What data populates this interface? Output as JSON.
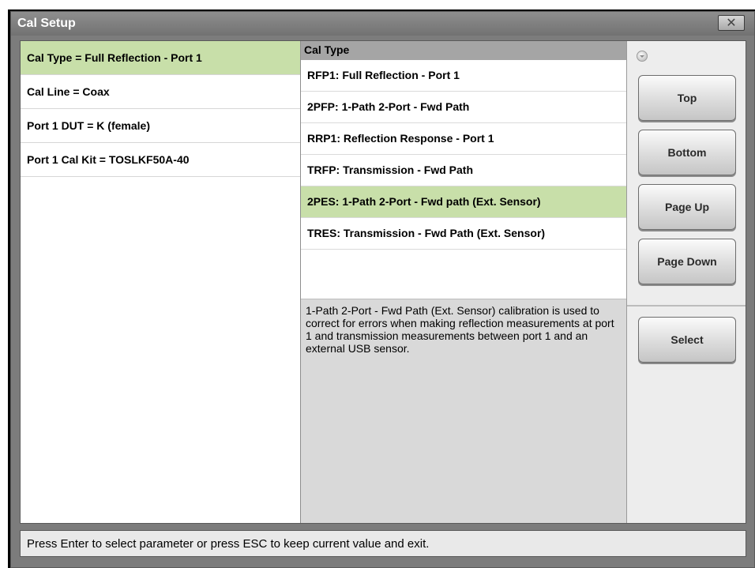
{
  "window": {
    "title": "Cal Setup",
    "close_symbol": "✕"
  },
  "left_panel": {
    "items": [
      {
        "label": "Cal Type = Full Reflection - Port 1",
        "selected": true
      },
      {
        "label": "Cal Line = Coax",
        "selected": false
      },
      {
        "label": "Port 1 DUT = K (female)",
        "selected": false
      },
      {
        "label": "Port 1 Cal Kit = TOSLKF50A-40",
        "selected": false
      }
    ]
  },
  "middle_panel": {
    "header": "Cal Type",
    "options": [
      {
        "label": "RFP1: Full Reflection - Port 1",
        "selected": false
      },
      {
        "label": "2PFP: 1-Path 2-Port - Fwd Path",
        "selected": false
      },
      {
        "label": "RRP1: Reflection Response - Port 1",
        "selected": false
      },
      {
        "label": "TRFP: Transmission - Fwd Path",
        "selected": false
      },
      {
        "label": "2PES: 1-Path 2-Port - Fwd path (Ext. Sensor)",
        "selected": true
      },
      {
        "label": "TRES: Transmission - Fwd Path (Ext. Sensor)",
        "selected": false
      }
    ],
    "description": "1-Path 2-Port - Fwd Path (Ext. Sensor) calibration is used to correct for errors when making reflection measurements at port 1 and transmission measurements between port 1 and an external USB sensor."
  },
  "right_panel": {
    "buttons": {
      "top": "Top",
      "bottom": "Bottom",
      "page_up": "Page Up",
      "page_down": "Page Down",
      "select": "Select"
    }
  },
  "status_bar": {
    "text": "Press Enter to select parameter or press ESC to keep current value and exit."
  },
  "colors": {
    "selection": "#c8dfa9",
    "title_bar": "#7c7c7c"
  }
}
